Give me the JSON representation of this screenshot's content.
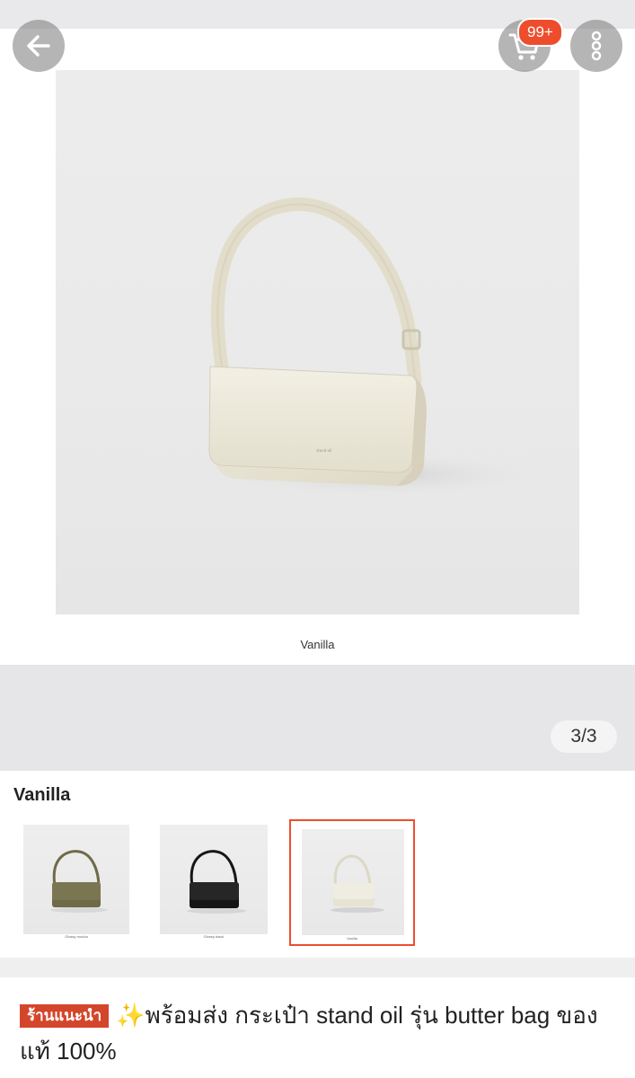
{
  "header": {
    "back_icon": "arrow-left-icon",
    "cart_icon": "shopping-cart-icon",
    "cart_badge": "99+",
    "more_icon": "vertical-dots-icon"
  },
  "gallery": {
    "image_caption": "Vanilla",
    "counter": "3/3",
    "current_index": 3,
    "total": 3
  },
  "variants": {
    "selected_label": "Vanilla",
    "options": [
      {
        "caption": "Glossy mocha",
        "color": "#6f6a48",
        "selected": false
      },
      {
        "caption": "Glossy black",
        "color": "#161616",
        "selected": false
      },
      {
        "caption": "Vanilla",
        "color": "#e7e3d2",
        "selected": true
      }
    ]
  },
  "product": {
    "shop_tag": "ร้านแนะนำ",
    "sparkle": "✨",
    "title": "พร้อมส่ง กระเป๋า stand oil รุ่น butter bag ของแท้ 100%"
  },
  "colors": {
    "accent": "#ee4d2d",
    "tag_bg": "#d4462c",
    "bag_vanilla": "#e9e5d3"
  }
}
